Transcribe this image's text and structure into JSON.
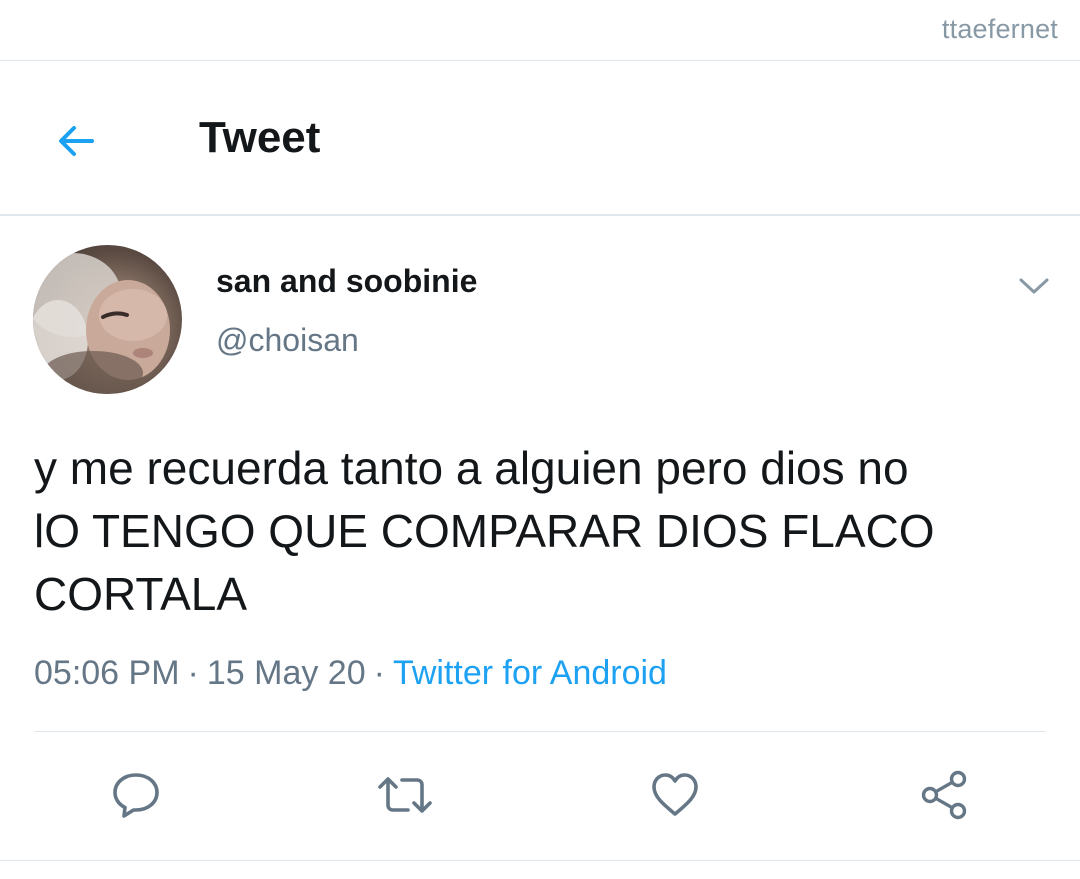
{
  "watermark": "ttaefernet",
  "header": {
    "back_icon": "arrow-left-icon",
    "title": "Tweet"
  },
  "tweet": {
    "author": {
      "display_name": "san and soobinie",
      "handle": "@choisan",
      "avatar": "profile-photo"
    },
    "menu_icon": "chevron-down-icon",
    "text": "y me recuerda tanto a alguien pero dios no\nlO TENGO QUE COMPARAR DIOS FLACO\nCORTALA",
    "time": "05:06 PM",
    "separator": "·",
    "date": "15 May 20",
    "source": "Twitter for Android"
  },
  "actions": [
    {
      "name": "reply",
      "icon": "speech-bubble-icon"
    },
    {
      "name": "retweet",
      "icon": "retweet-icon"
    },
    {
      "name": "like",
      "icon": "heart-icon"
    },
    {
      "name": "share",
      "icon": "share-icon"
    }
  ],
  "colors": {
    "accent": "#1da1f2",
    "text_primary": "#14171a",
    "text_secondary": "#657786",
    "icon_gray": "#657786",
    "divider": "#e1e8ed"
  }
}
